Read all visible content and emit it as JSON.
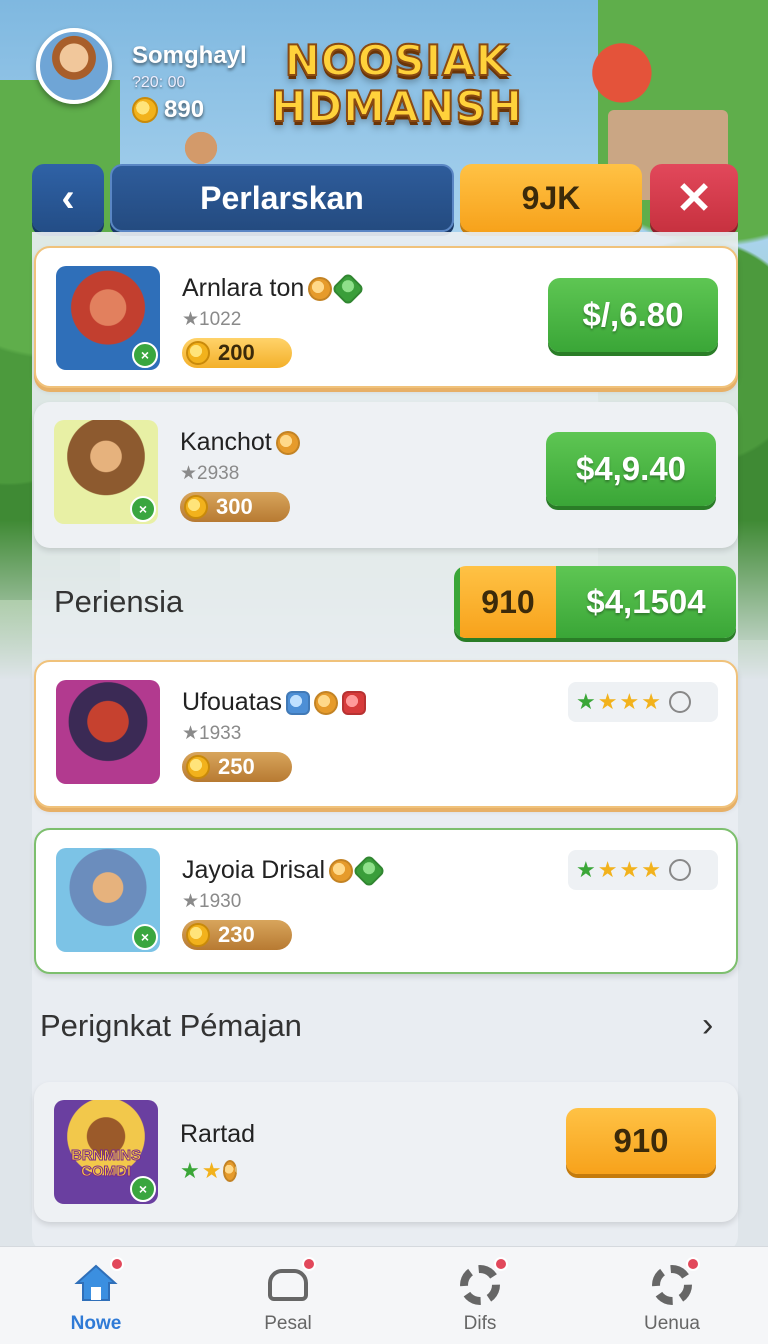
{
  "header": {
    "player_name": "Somghayl",
    "player_id": "?20: 00",
    "player_coins": "890",
    "game_title": "NOOSIAK HDMANSH"
  },
  "topbar": {
    "back_label": "‹",
    "title": "Perlarskan",
    "currency_label": "9JK",
    "close_label": "✕"
  },
  "items": [
    {
      "name": "Arnlara ton",
      "rating": "★1022",
      "coins": "200",
      "price": "$/,6.80",
      "gems": [
        "gold",
        "green"
      ]
    },
    {
      "name": "Kanchot",
      "rating": "★2938",
      "coins": "300",
      "price": "$4,9.40",
      "gems": [
        "gold"
      ]
    }
  ],
  "section_periensia": {
    "title": "Periensia",
    "combo_left": "910",
    "combo_right": "$4,1504"
  },
  "reward_items": [
    {
      "name": "Ufouatas",
      "rating": "★1933",
      "coins": "250",
      "stars_filled": 4,
      "stars_total": 5,
      "gems": [
        "blue",
        "gold",
        "red"
      ]
    },
    {
      "name": "Jayoia Drisal",
      "rating": "★1930",
      "coins": "230",
      "stars_filled": 4,
      "stars_total": 5,
      "gems": [
        "gold",
        "green"
      ]
    }
  ],
  "section_ranking": {
    "title": "Perignkat Pémajan"
  },
  "ranking_item": {
    "name": "Rartad",
    "thumb_text": "BRNMINS COMDI",
    "action_label": "910"
  },
  "bottom_nav": [
    {
      "label": "Nowe",
      "icon": "home-icon",
      "active": true
    },
    {
      "label": "Pesal",
      "icon": "car-icon",
      "active": false
    },
    {
      "label": "Difs",
      "icon": "gear-icon",
      "active": false
    },
    {
      "label": "Uenua",
      "icon": "settings-icon",
      "active": false
    }
  ],
  "colors": {
    "primary_blue": "#2e5c9b",
    "accent_orange": "#f7a21b",
    "buy_green": "#3aa637",
    "close_red": "#c7313f",
    "nav_active": "#2f7ad6"
  }
}
